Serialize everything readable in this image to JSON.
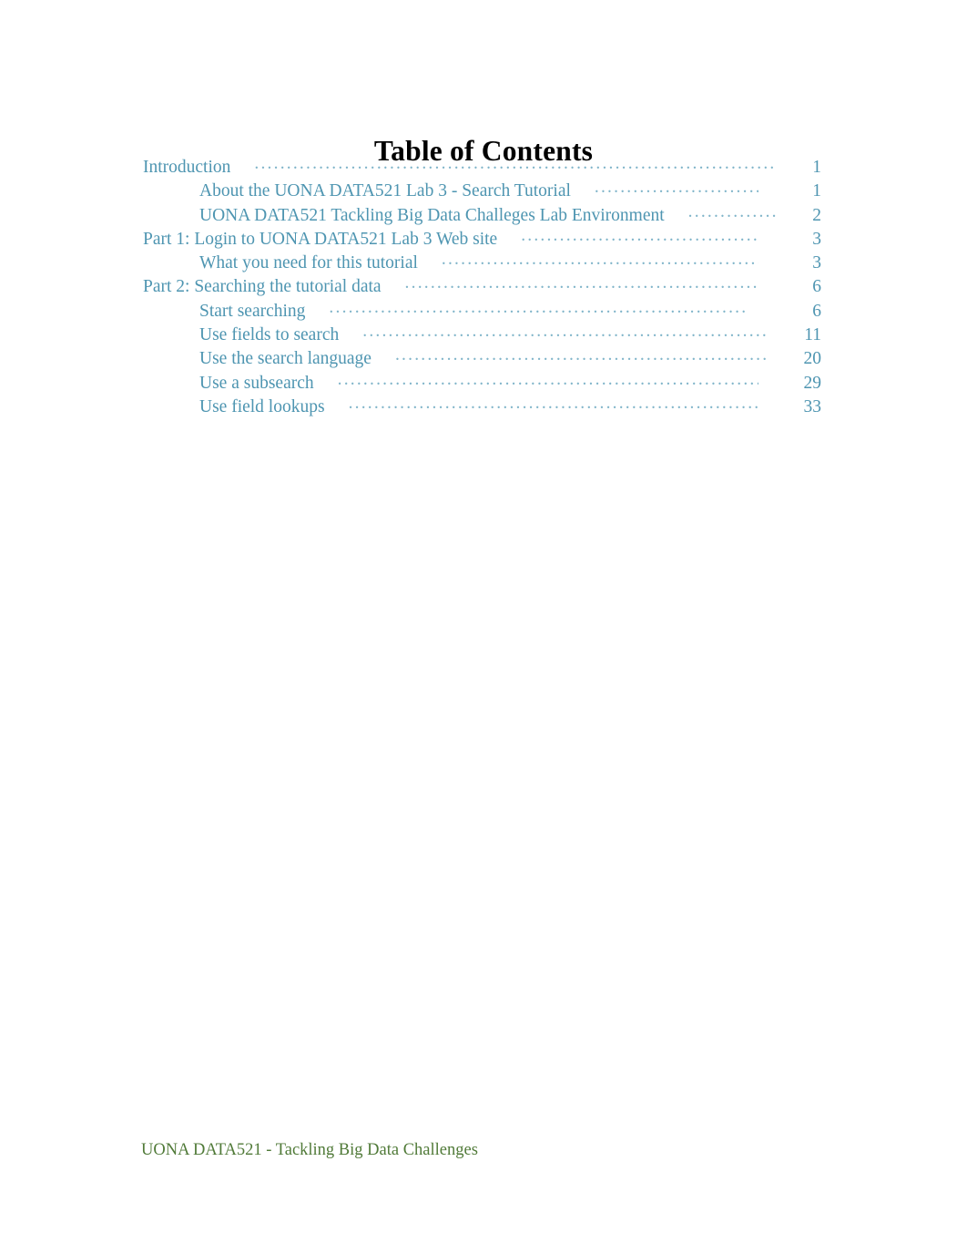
{
  "document": {
    "title": "Table of Contents",
    "footer": "UONA DATA521 - Tackling Big Data Challenges",
    "colors": {
      "title": "#000000",
      "entry": "#4e95b1",
      "leader": "#7fb4c9",
      "footer": "#507a38",
      "page_background": "#ffffff"
    }
  },
  "toc": {
    "entries": [
      {
        "label": "Introduction",
        "page": "1",
        "level": 1,
        "leader_trim": 1
      },
      {
        "label": "About the UONA DATA521 Lab 3 - Search Tutorial",
        "page": "1",
        "level": 2,
        "leader_trim": 3
      },
      {
        "label": "UONA DATA521 Tackling Big Data Challeges Lab Environment",
        "page": "2",
        "level": 2,
        "leader_trim": 1
      },
      {
        "label": "Part 1: Login to UONA DATA521 Lab 3 Web site",
        "page": "3",
        "level": 1,
        "leader_trim": 3
      },
      {
        "label": "What you need for this tutorial",
        "page": "3",
        "level": 2,
        "leader_trim": 3
      },
      {
        "label": "Part 2: Searching the tutorial data",
        "page": "6",
        "level": 1,
        "leader_trim": 3
      },
      {
        "label": "Start searching",
        "page": "6",
        "level": 2,
        "leader_trim": 4
      },
      {
        "label": "Use fields to search",
        "page": "11",
        "level": 2,
        "leader_trim": 2
      },
      {
        "label": "Use the search language",
        "page": "20",
        "level": 2,
        "leader_trim": 2
      },
      {
        "label": "Use a subsearch",
        "page": "29",
        "level": 2,
        "leader_trim": 3
      },
      {
        "label": "Use field lookups",
        "page": "33",
        "level": 2,
        "leader_trim": 3
      }
    ]
  }
}
